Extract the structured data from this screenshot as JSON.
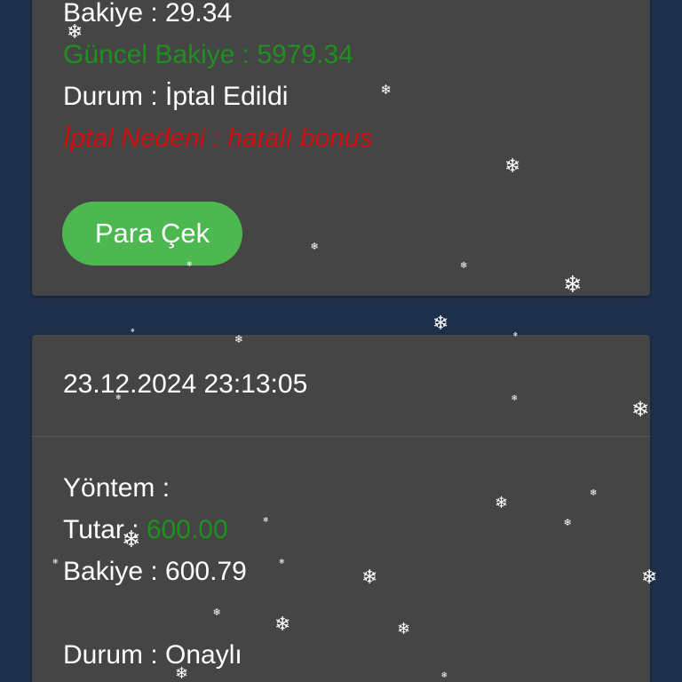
{
  "card1": {
    "balance_line": "Bakiye : 29.34",
    "current_balance_line": "Güncel Bakiye : 5979.34",
    "status_line": "Durum : İptal Edildi",
    "cancel_reason_line": "İptal Nedeni : hatalı bonus",
    "withdraw_button": "Para Çek"
  },
  "card2": {
    "datetime": "23.12.2024 23:13:05",
    "method_line": "Yöntem :",
    "amount_label": "Tutar : ",
    "amount_value": "600.00",
    "balance_line": "Bakiye : 600.79",
    "status_line": "Durum : Onaylı"
  },
  "colors": {
    "background": "#1e2f4b",
    "card": "#454545",
    "green_text": "#1f8f1f",
    "red_text": "#d10f0f",
    "button": "#4cb84f"
  },
  "decoration": {
    "snowflake_glyph": "❄"
  }
}
